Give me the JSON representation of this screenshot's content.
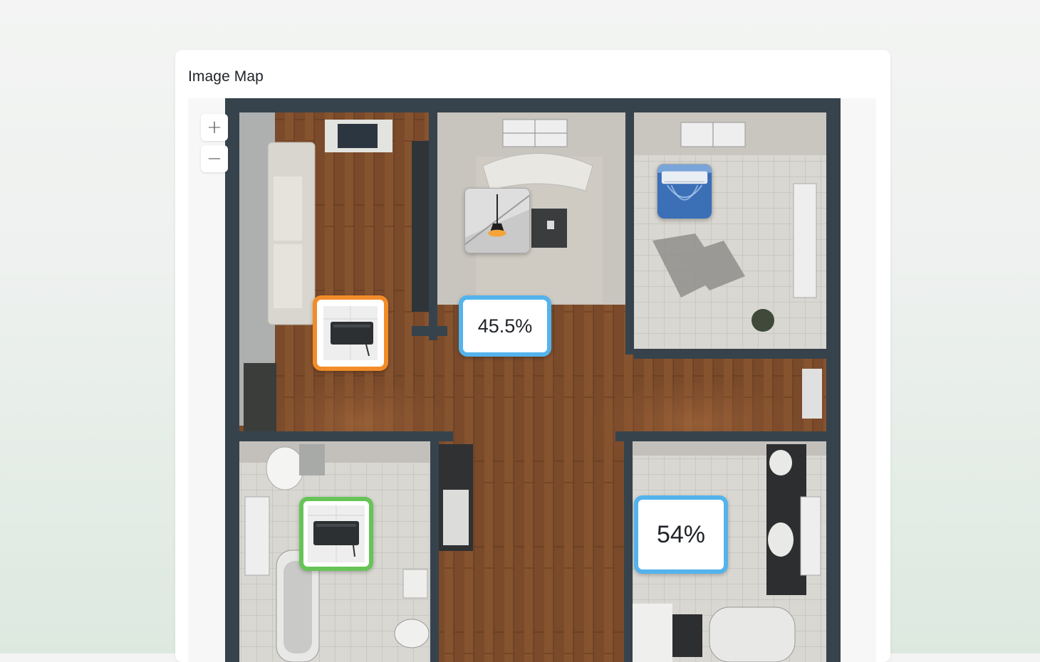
{
  "card": {
    "title": "Image Map"
  },
  "zoom": {
    "in_label": "+",
    "out_label": "−"
  },
  "markers": [
    {
      "id": "heater-living",
      "type": "heater-icon",
      "color": "#f28c28"
    },
    {
      "id": "light-living",
      "type": "pendant-light-icon",
      "color": "#cccccc"
    },
    {
      "id": "ac-bedroom",
      "type": "air-conditioner-icon",
      "color": "#3b78c4"
    },
    {
      "id": "humidity-living",
      "value": "45.5%",
      "color": "#54b3ec"
    },
    {
      "id": "heater-bathroom",
      "type": "heater-icon",
      "color": "#66c457"
    },
    {
      "id": "humidity-bathroom",
      "value": "54%",
      "color": "#54b3ec"
    }
  ]
}
